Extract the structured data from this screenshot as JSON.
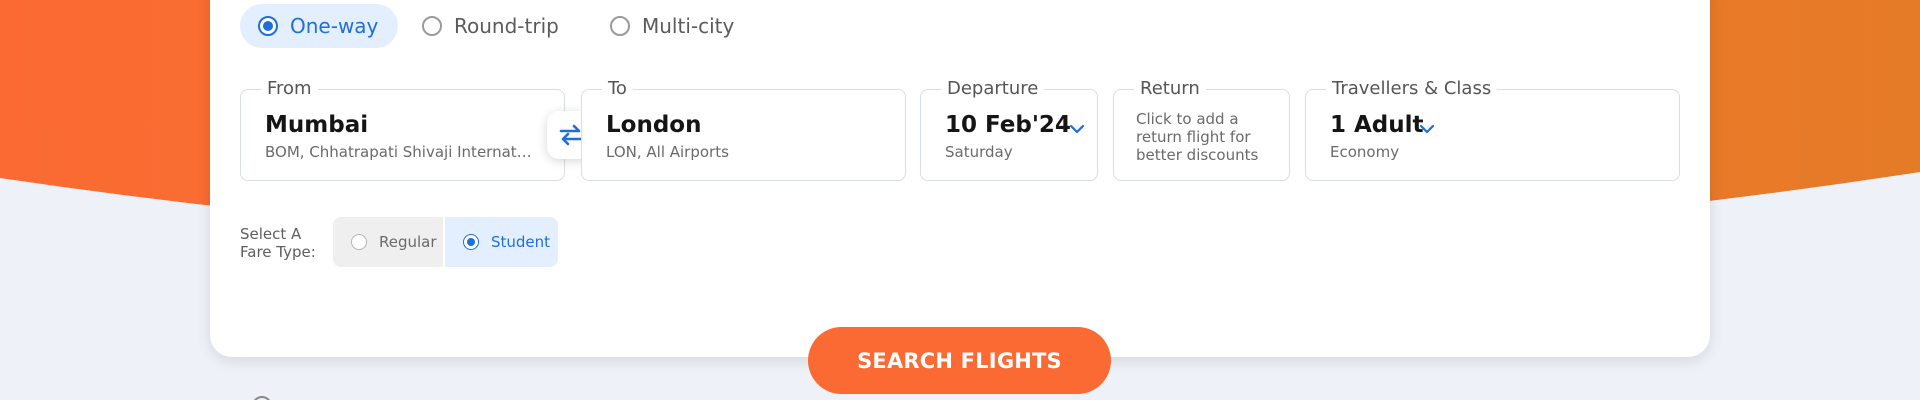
{
  "trip_types": [
    {
      "label": "One-way",
      "selected": true
    },
    {
      "label": "Round-trip",
      "selected": false
    },
    {
      "label": "Multi-city",
      "selected": false
    }
  ],
  "from": {
    "label": "From",
    "city": "Mumbai",
    "detail": "BOM, Chhatrapati Shivaji Internatio..."
  },
  "to": {
    "label": "To",
    "city": "London",
    "detail": "LON, All Airports"
  },
  "departure": {
    "label": "Departure",
    "date": "10 Feb'24",
    "day": "Saturday"
  },
  "return": {
    "label": "Return",
    "note": "Click to add a return flight for better discounts"
  },
  "travellers": {
    "label": "Travellers & Class",
    "count": "1 Adult",
    "class": "Economy"
  },
  "fare_type": {
    "label": "Select A Fare Type:",
    "options": [
      {
        "label": "Regular",
        "selected": false
      },
      {
        "label": "Student",
        "selected": true
      }
    ]
  },
  "search_button": "SEARCH FLIGHTS",
  "colors": {
    "accent": "#1f6fd8",
    "brand_orange": "#fb6a33",
    "background": "#eef1f8"
  },
  "icons": [
    "swap-arrows-icon",
    "chevron-down-icon",
    "radio-icon"
  ]
}
